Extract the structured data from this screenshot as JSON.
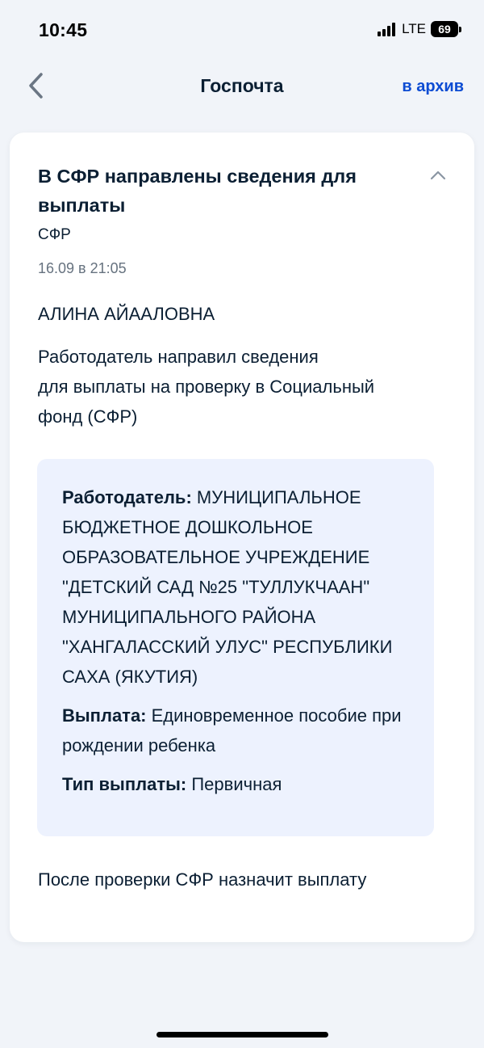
{
  "status_bar": {
    "time": "10:45",
    "network": "LTE",
    "battery_level": "69"
  },
  "header": {
    "title": "Госпочта",
    "archive_label": "в архив",
    "back_icon": "chevron-left-icon"
  },
  "message": {
    "title": "В СФР направлены сведения для выплаты",
    "sender": "СФР",
    "date": "16.09 в 21:05",
    "recipient": "АЛИНА АЙААЛОВНА",
    "body_line1": "Работодатель направил сведения",
    "body_line2": "для выплаты на проверку в Социальный",
    "body_line3": "фонд (СФР)",
    "details": {
      "employer_label": "Работодатель:",
      "employer_value": "МУНИЦИПАЛЬНОЕ БЮДЖЕТНОЕ ДОШКОЛЬНОЕ ОБРАЗОВАТЕЛЬНОЕ УЧРЕЖДЕНИЕ \"ДЕТСКИЙ САД №25 \"ТУЛЛУКЧААН\" МУНИЦИПАЛЬНОГО РАЙОНА \"ХАНГАЛАССКИЙ УЛУС\" РЕСПУБЛИКИ САХА (ЯКУТИЯ)",
      "payment_label": "Выплата:",
      "payment_value": "Единовременное пособие при рождении ребенка",
      "payment_type_label": "Тип выплаты:",
      "payment_type_value": "Первичная"
    },
    "footer": "После проверки СФР назначит выплату",
    "collapse_icon": "chevron-up-icon"
  },
  "colors": {
    "accent": "#0d4cd3",
    "text": "#0b1f33",
    "muted": "#66727f",
    "page_background": "#f1f4f9",
    "info_background": "#edf2fe"
  }
}
